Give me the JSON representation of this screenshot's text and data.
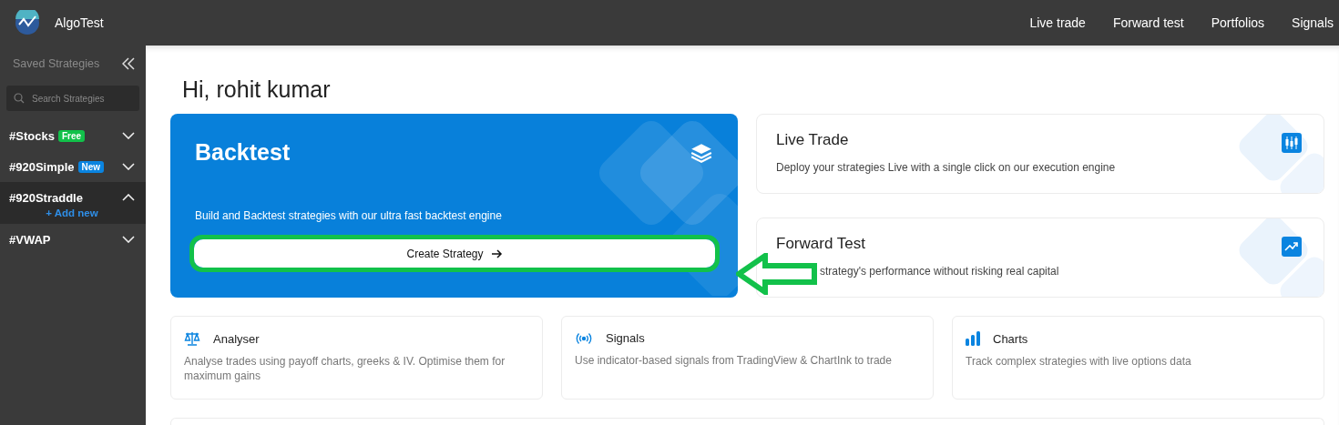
{
  "app": {
    "name": "AlgoTest"
  },
  "nav": [
    "Live trade",
    "Forward test",
    "Portfolios",
    "Signals"
  ],
  "sidebar": {
    "title": "Saved Strategies",
    "search": {
      "placeholder": "Search Strategies"
    },
    "items": [
      {
        "name": "#Stocks",
        "badge": {
          "text": "Free",
          "color": "#12c14a"
        },
        "expanded": false
      },
      {
        "name": "#920Simple",
        "badge": {
          "text": "New",
          "color": "#0a84e0"
        },
        "expanded": false
      },
      {
        "name": "#920Straddle",
        "expanded": true,
        "action": "+ Add new"
      },
      {
        "name": "#VWAP",
        "expanded": false
      }
    ]
  },
  "greeting": "Hi, rohit kumar",
  "backtest": {
    "title": "Backtest",
    "description": "Build and Backtest strategies with our ultra fast backtest engine",
    "button": "Create Strategy"
  },
  "side_cards": [
    {
      "kind": "candles",
      "title": "Live Trade",
      "description": "Deploy your strategies Live with a single click on our execution engine"
    },
    {
      "kind": "trend",
      "title": "Forward Test",
      "description": "strategy's performance without risking real capital"
    }
  ],
  "tools": [
    {
      "kind": "scale",
      "title": "Analyser",
      "description": "Analyse trades using payoff charts, greeks & IV. Optimise them for maximum gains"
    },
    {
      "kind": "signal",
      "title": "Signals",
      "description": "Use indicator-based signals from TradingView & ChartInk to trade"
    },
    {
      "kind": "bars",
      "title": "Charts",
      "description": "Track complex strategies with live options data"
    }
  ]
}
